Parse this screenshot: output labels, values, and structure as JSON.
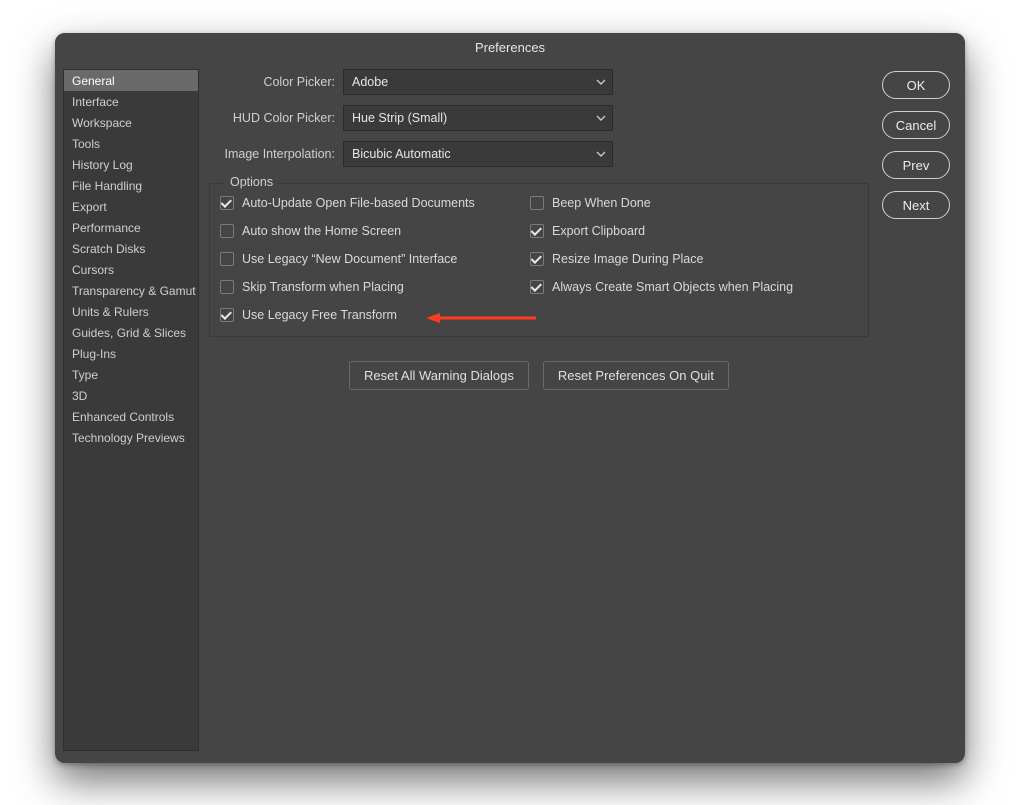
{
  "window": {
    "title": "Preferences"
  },
  "sidebar": {
    "items": [
      "General",
      "Interface",
      "Workspace",
      "Tools",
      "History Log",
      "File Handling",
      "Export",
      "Performance",
      "Scratch Disks",
      "Cursors",
      "Transparency & Gamut",
      "Units & Rulers",
      "Guides, Grid & Slices",
      "Plug-Ins",
      "Type",
      "3D",
      "Enhanced Controls",
      "Technology Previews"
    ],
    "selected_index": 0
  },
  "dropdowns": {
    "color_picker": {
      "label": "Color Picker:",
      "value": "Adobe"
    },
    "hud_color_picker": {
      "label": "HUD Color Picker:",
      "value": "Hue Strip (Small)"
    },
    "image_interpolation": {
      "label": "Image Interpolation:",
      "value": "Bicubic Automatic"
    }
  },
  "options": {
    "legend": "Options",
    "left": [
      {
        "label": "Auto-Update Open File-based Documents",
        "checked": true
      },
      {
        "label": "Auto show the Home Screen",
        "checked": false
      },
      {
        "label": "Use Legacy “New Document” Interface",
        "checked": false
      },
      {
        "label": "Skip Transform when Placing",
        "checked": false
      },
      {
        "label": "Use Legacy Free Transform",
        "checked": true
      }
    ],
    "right": [
      {
        "label": "Beep When Done",
        "checked": false
      },
      {
        "label": "Export Clipboard",
        "checked": true
      },
      {
        "label": "Resize Image During Place",
        "checked": true
      },
      {
        "label": "Always Create Smart Objects when Placing",
        "checked": true
      }
    ]
  },
  "bottom_buttons": {
    "reset_warnings": "Reset All Warning Dialogs",
    "reset_prefs": "Reset Preferences On Quit"
  },
  "right_buttons": {
    "ok": "OK",
    "cancel": "Cancel",
    "prev": "Prev",
    "next": "Next"
  }
}
